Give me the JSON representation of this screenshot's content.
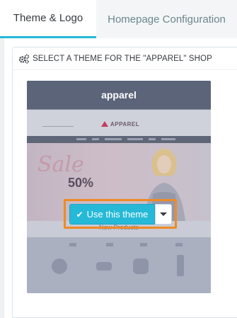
{
  "tabs": [
    {
      "label": "Theme & Logo",
      "active": true
    },
    {
      "label": "Homepage Configuration",
      "active": false
    }
  ],
  "panel": {
    "title": "SELECT A THEME FOR THE \"APPAREL\" SHOP",
    "icon": "gears-icon"
  },
  "theme_card": {
    "name": "apparel",
    "preview": {
      "logo_text": "APPAREL",
      "sale_text": "Sale",
      "percent_text": "50%",
      "section_title": "New Products"
    },
    "use_button_label": "Use this theme",
    "dropdown_icon": "caret-down-icon"
  },
  "colors": {
    "accent": "#25b9d7",
    "highlight_border": "#f08a24"
  }
}
